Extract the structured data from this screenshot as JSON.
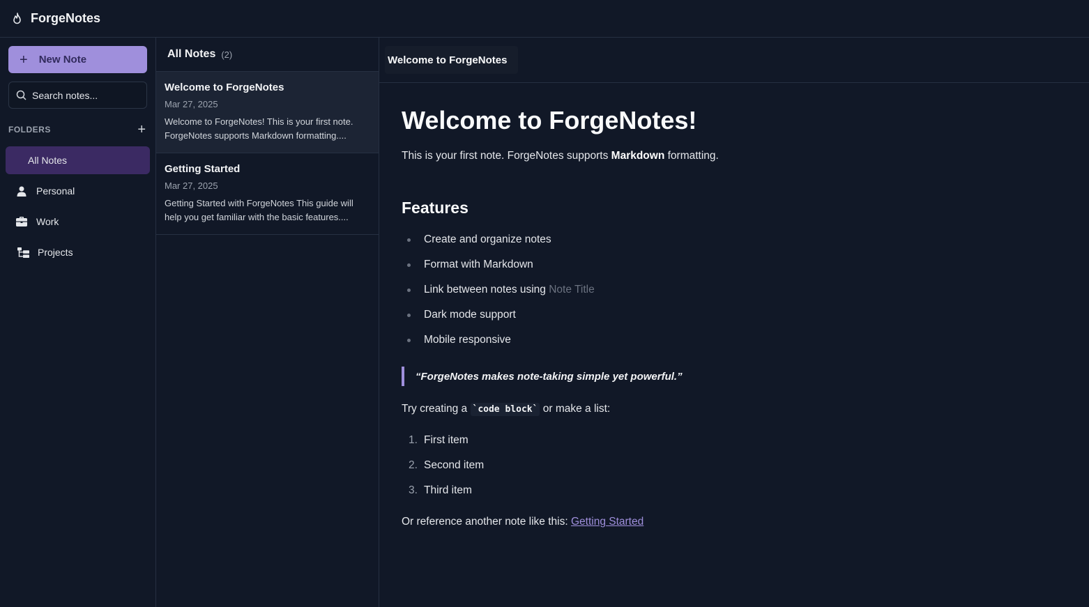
{
  "app": {
    "title": "ForgeNotes",
    "icon": "flame-icon"
  },
  "sidebar": {
    "new_note_label": "New Note",
    "search_placeholder": "Search notes...",
    "folders_title": "FOLDERS",
    "folders": [
      {
        "label": "All Notes",
        "icon": "",
        "active": true
      },
      {
        "label": "Personal",
        "icon": "user-icon"
      },
      {
        "label": "Work",
        "icon": "briefcase-icon"
      },
      {
        "label": "Projects",
        "icon": "folder-tree-icon"
      }
    ]
  },
  "notes_list": {
    "title": "All Notes",
    "count": "(2)",
    "notes": [
      {
        "title": "Welcome to ForgeNotes",
        "date": "Mar 27, 2025",
        "preview": "Welcome to ForgeNotes! This is your first note. ForgeNotes supports Markdown formatting....",
        "active": true
      },
      {
        "title": "Getting Started",
        "date": "Mar 27, 2025",
        "preview": "Getting Started with ForgeNotes This guide will help you get familiar with the basic features...."
      }
    ]
  },
  "editor": {
    "note_title": "Welcome to ForgeNotes",
    "heading": "Welcome to ForgeNotes!",
    "intro_before": "This is your first note. ForgeNotes supports ",
    "intro_bold": "Markdown",
    "intro_after": " formatting.",
    "features_heading": "Features",
    "features": [
      "Create and organize notes",
      "Format with Markdown",
      "Link between notes using ",
      "Dark mode support",
      "Mobile responsive"
    ],
    "feature_link_text": "Note Title",
    "quote": "“ForgeNotes makes note-taking simple yet powerful.”",
    "try_before": "Try creating a ",
    "try_code": "`code block`",
    "try_after": " or make a list:",
    "ordered": [
      {
        "num": "1.",
        "text": "First item"
      },
      {
        "num": "2.",
        "text": "Second item"
      },
      {
        "num": "3.",
        "text": "Third item"
      }
    ],
    "ref_before": "Or reference another note like this: ",
    "ref_link": "Getting Started"
  },
  "colors": {
    "background": "#111827",
    "accent": "#9f8fdc",
    "active_folder": "#3b2a63",
    "border": "#263042"
  }
}
